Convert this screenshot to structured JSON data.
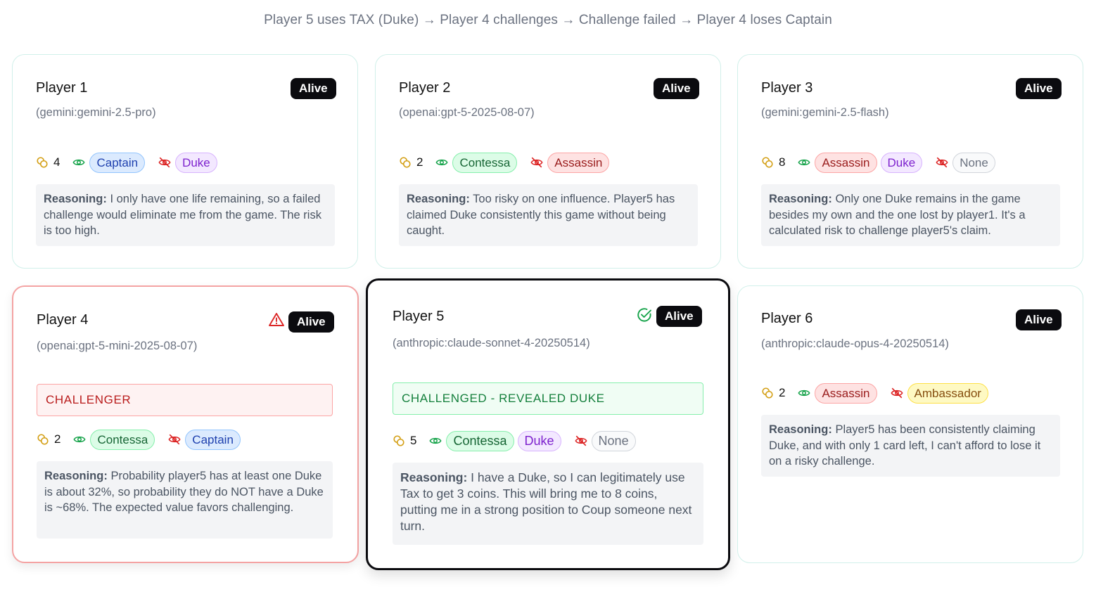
{
  "summary": "Player 5 uses TAX (Duke) → Player 4 challenges → Challenge failed → Player 4 loses Captain",
  "reasoning_label": "Reasoning:",
  "players": [
    {
      "name": "Player 1",
      "model": "(gemini:gemini-2.5-pro)",
      "status": "Alive",
      "coins": "4",
      "revealed": [
        "Captain"
      ],
      "hidden": [
        "Duke"
      ],
      "reasoning": "I only have one life remaining, so a failed challenge would eliminate me from the game. The risk is too high."
    },
    {
      "name": "Player 2",
      "model": "(openai:gpt-5-2025-08-07)",
      "status": "Alive",
      "coins": "2",
      "revealed": [
        "Contessa"
      ],
      "hidden": [
        "Assassin"
      ],
      "reasoning": "Too risky on one influence. Player5 has claimed Duke consistently this game without being caught."
    },
    {
      "name": "Player 3",
      "model": "(gemini:gemini-2.5-flash)",
      "status": "Alive",
      "coins": "8",
      "revealed": [
        "Assassin",
        "Duke"
      ],
      "hidden": [
        "None"
      ],
      "reasoning": "Only one Duke remains in the game besides my own and the one lost by player1. It's a calculated risk to challenge player5's claim."
    },
    {
      "name": "Player 4",
      "model": "(openai:gpt-5-mini-2025-08-07)",
      "status": "Alive",
      "status_icon": "warning-icon",
      "banner": "CHALLENGER",
      "coins": "2",
      "revealed": [
        "Contessa"
      ],
      "hidden": [
        "Captain"
      ],
      "reasoning": "Probability player5 has at least one Duke is about 32%, so probability they do NOT have a Duke is ~68%. The expected value favors challenging."
    },
    {
      "name": "Player 5",
      "model": "(anthropic:claude-sonnet-4-20250514)",
      "status": "Alive",
      "status_icon": "check-circle-icon",
      "banner": "CHALLENGED - REVEALED DUKE",
      "coins": "5",
      "revealed": [
        "Contessa",
        "Duke"
      ],
      "hidden": [
        "None"
      ],
      "reasoning": "I have a Duke, so I can legitimately use Tax to get 3 coins. This will bring me to 8 coins, putting me in a strong position to Coup someone next turn."
    },
    {
      "name": "Player 6",
      "model": "(anthropic:claude-opus-4-20250514)",
      "status": "Alive",
      "coins": "2",
      "revealed": [
        "Assassin"
      ],
      "hidden": [
        "Ambassador"
      ],
      "reasoning": "Player5 has been consistently claiming Duke, and with only 1 card left, I can't afford to lose it on a risky challenge."
    }
  ],
  "colors": {
    "alive_badge": "#0b0b0f",
    "challenger_border": "#f4a3a3",
    "challenged_border": "#0b0b0f",
    "warning": "#dc2626",
    "success": "#16a34a",
    "coin": "#d4a017"
  }
}
